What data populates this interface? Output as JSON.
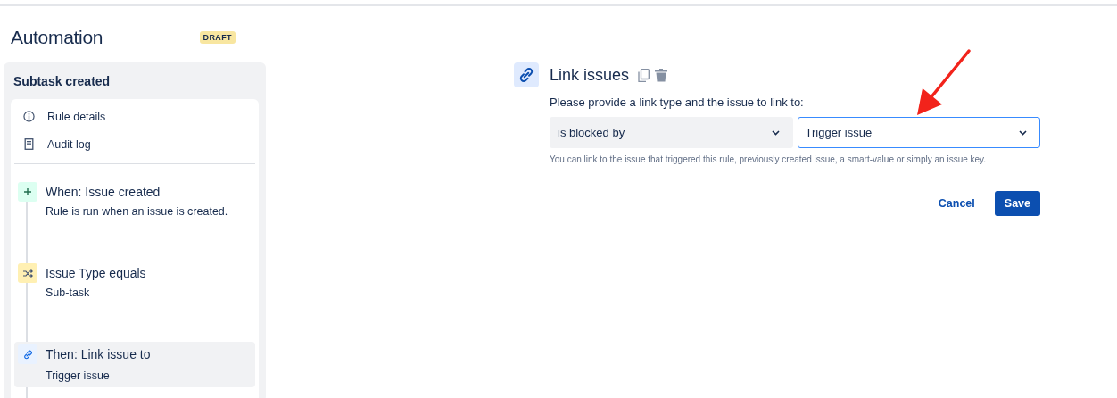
{
  "header": {
    "title": "Automation",
    "badge": "DRAFT"
  },
  "sidebar": {
    "title": "Subtask created",
    "links": [
      {
        "kind": "info",
        "label": "Rule details"
      },
      {
        "kind": "log",
        "label": "Audit log"
      }
    ],
    "steps": [
      {
        "kind": "trigger",
        "title": "When: Issue created",
        "detail": "Rule is run when an issue is created.",
        "selected": false
      },
      {
        "kind": "condition",
        "title": "Issue Type equals",
        "detail": "Sub-task",
        "selected": false
      },
      {
        "kind": "action",
        "title": "Then: Link issue to",
        "detail": "Trigger issue",
        "selected": true
      }
    ]
  },
  "editor": {
    "title": "Link issues",
    "prompt": "Please provide a link type and the issue to link to:",
    "link_type": {
      "value": "is blocked by",
      "focused": false
    },
    "issue": {
      "value": "Trigger issue",
      "focused": true
    },
    "help": "You can link to the issue that triggered this rule, previously created issue, a smart-value or simply an issue key.",
    "buttons": [
      {
        "kind": "secondary",
        "label": "Cancel"
      },
      {
        "kind": "primary",
        "label": "Save"
      }
    ]
  }
}
